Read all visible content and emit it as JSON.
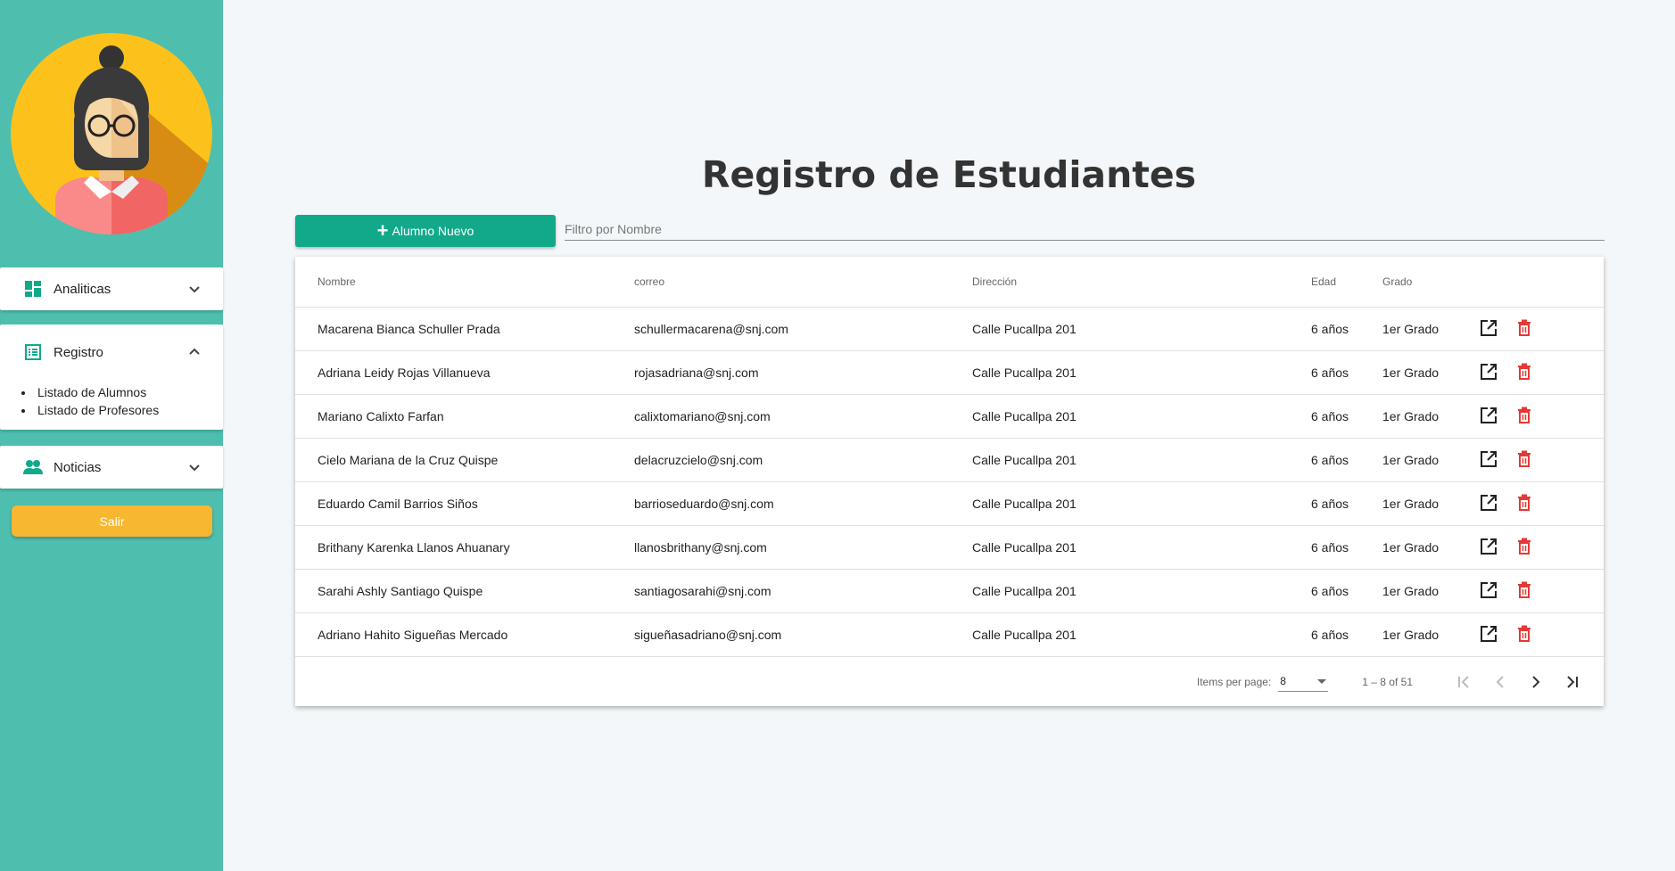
{
  "sidebar": {
    "sections": [
      {
        "title": "Analiticas",
        "icon": "dashboard-icon",
        "expanded": false
      },
      {
        "title": "Registro",
        "icon": "list-alt-icon",
        "expanded": true,
        "items": [
          "Listado de Alumnos",
          "Listado de Profesores"
        ]
      },
      {
        "title": "Noticias",
        "icon": "people-icon",
        "expanded": false
      }
    ],
    "exit_label": "Salir"
  },
  "main": {
    "title": "Registro de Estudiantes",
    "add_label": "Alumno Nuevo",
    "filter_placeholder": "Filtro por Nombre",
    "table": {
      "headers": [
        "Nombre",
        "correo",
        "Dirección",
        "Edad",
        "Grado"
      ],
      "rows": [
        [
          "Macarena Bianca Schuller Prada",
          "schullermacarena@snj.com",
          "Calle Pucallpa 201",
          "6 años",
          "1er Grado"
        ],
        [
          "Adriana Leidy Rojas Villanueva",
          "rojasadriana@snj.com",
          "Calle Pucallpa 201",
          "6 años",
          "1er Grado"
        ],
        [
          "Mariano Calixto Farfan",
          "calixtomariano@snj.com",
          "Calle Pucallpa 201",
          "6 años",
          "1er Grado"
        ],
        [
          "Cielo Mariana de la Cruz Quispe",
          "delacruzcielo@snj.com",
          "Calle Pucallpa 201",
          "6 años",
          "1er Grado"
        ],
        [
          "Eduardo Camil Barrios Siños",
          "barrioseduardo@snj.com",
          "Calle Pucallpa 201",
          "6 años",
          "1er Grado"
        ],
        [
          "Brithany Karenka Llanos Ahuanary",
          "llanosbrithany@snj.com",
          "Calle Pucallpa 201",
          "6 años",
          "1er Grado"
        ],
        [
          "Sarahi Ashly Santiago Quispe",
          "santiagosarahi@snj.com",
          "Calle Pucallpa 201",
          "6 años",
          "1er Grado"
        ],
        [
          "Adriano Hahito Sigueñas Mercado",
          "sigueñasadriano@snj.com",
          "Calle Pucallpa 201",
          "6 años",
          "1er Grado"
        ]
      ]
    },
    "paginator": {
      "items_per_page_label": "Items per page:",
      "items_per_page": "8",
      "range": "1 – 8 of 51"
    }
  },
  "colors": {
    "sidebar": "#4ebeae",
    "primary": "#12a98a",
    "exit": "#f7b731",
    "delete": "#e53935"
  }
}
